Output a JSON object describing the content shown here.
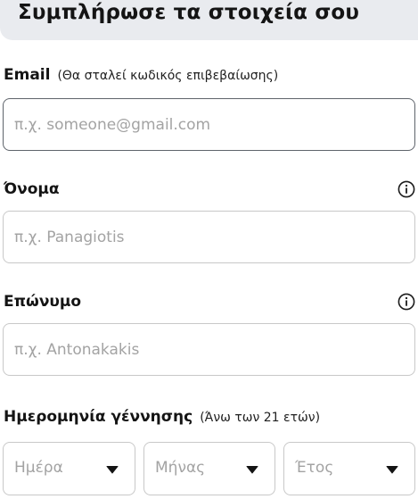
{
  "header": {
    "title": "Συμπλήρωσε τα στοιχεία σου"
  },
  "email": {
    "label": "Email",
    "hint": "(Θα σταλεί κωδικός επιβεβαίωσης)",
    "placeholder": "π.χ. someone@gmail.com",
    "value": ""
  },
  "first_name": {
    "label": "Όνομα",
    "placeholder": "π.χ. Panagiotis",
    "value": "",
    "icon": "info-icon"
  },
  "last_name": {
    "label": "Επώνυμο",
    "placeholder": "π.χ. Antonakakis",
    "value": "",
    "icon": "info-icon"
  },
  "birth_date": {
    "label": "Ημερομηνία γέννησης",
    "hint": "(Άνω των 21 ετών)",
    "day_placeholder": "Ημέρα",
    "month_placeholder": "Μήνας",
    "year_placeholder": "Έτος",
    "dropdown_icon": "caret-down-icon"
  },
  "colors": {
    "header_bg": "#e9ebef",
    "border": "#c8c8c8",
    "focused_border": "#5f646b",
    "placeholder": "#a3a3a3"
  }
}
